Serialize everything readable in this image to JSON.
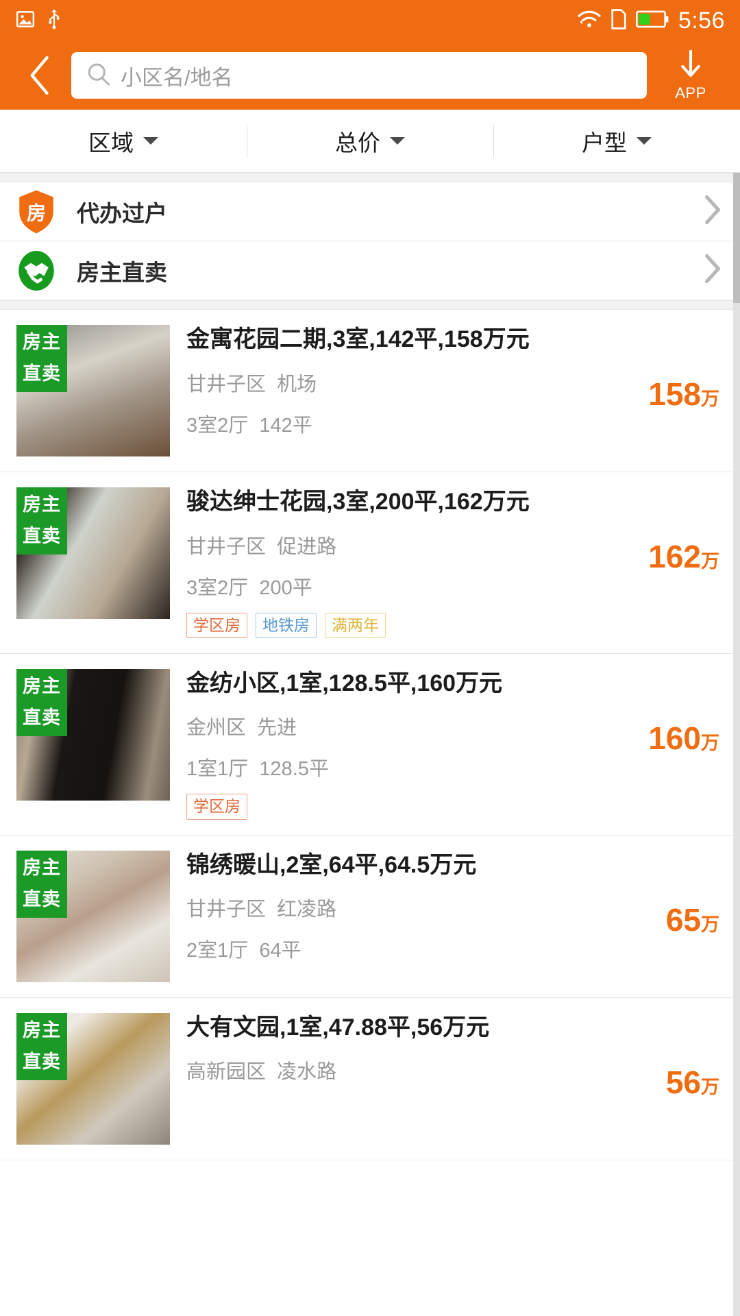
{
  "statusbar": {
    "time": "5:56",
    "icons": [
      "image-icon",
      "usb-icon",
      "wifi-icon",
      "sim-icon",
      "battery-icon"
    ]
  },
  "header": {
    "back_icon": "back-chevron-icon",
    "search": {
      "placeholder": "小区名/地名",
      "icon": "search-icon",
      "value": ""
    },
    "app_button": {
      "label": "APP",
      "icon": "download-arrow-icon"
    }
  },
  "filters": [
    {
      "label": "区域",
      "icon": "chevron-down-icon"
    },
    {
      "label": "总价",
      "icon": "chevron-down-icon"
    },
    {
      "label": "户型",
      "icon": "chevron-down-icon"
    }
  ],
  "services": [
    {
      "label": "代办过户",
      "icon": "shield-house-icon",
      "glyph": "房",
      "color": "#ef6c10",
      "shape": "shield"
    },
    {
      "label": "房主直卖",
      "icon": "handshake-icon",
      "glyph": "",
      "color": "#169b1e",
      "shape": "circle"
    }
  ],
  "badge_text": {
    "line1": "房主",
    "line2": "直卖"
  },
  "listings": [
    {
      "title": "金寓花园二期,3室,142平,158万元",
      "district": "甘井子区",
      "street": "机场",
      "layout": "3室2厅",
      "area": "142平",
      "price_num": "158",
      "price_unit": "万",
      "tags": [],
      "badge": true
    },
    {
      "title": "骏达绅士花园,3室,200平,162万元",
      "district": "甘井子区",
      "street": "促进路",
      "layout": "3室2厅",
      "area": "200平",
      "price_num": "162",
      "price_unit": "万",
      "tags": [
        {
          "label": "学区房",
          "style": "school"
        },
        {
          "label": "地铁房",
          "style": "metro"
        },
        {
          "label": "满两年",
          "style": "twoyr"
        }
      ],
      "badge": true
    },
    {
      "title": "金纺小区,1室,128.5平,160万元",
      "district": "金州区",
      "street": "先进",
      "layout": "1室1厅",
      "area": "128.5平",
      "price_num": "160",
      "price_unit": "万",
      "tags": [
        {
          "label": "学区房",
          "style": "school"
        }
      ],
      "badge": true
    },
    {
      "title": "锦绣暖山,2室,64平,64.5万元",
      "district": "甘井子区",
      "street": "红凌路",
      "layout": "2室1厅",
      "area": "64平",
      "price_num": "65",
      "price_unit": "万",
      "tags": [],
      "badge": true
    },
    {
      "title": "大有文园,1室,47.88平,56万元",
      "district": "高新园区",
      "street": "凌水路",
      "layout": "",
      "area": "",
      "price_num": "56",
      "price_unit": "万",
      "tags": [],
      "badge": true
    }
  ],
  "colors": {
    "brand_orange": "#ef6c10",
    "badge_green": "#1c9a28",
    "price_orange": "#ef6c10"
  }
}
